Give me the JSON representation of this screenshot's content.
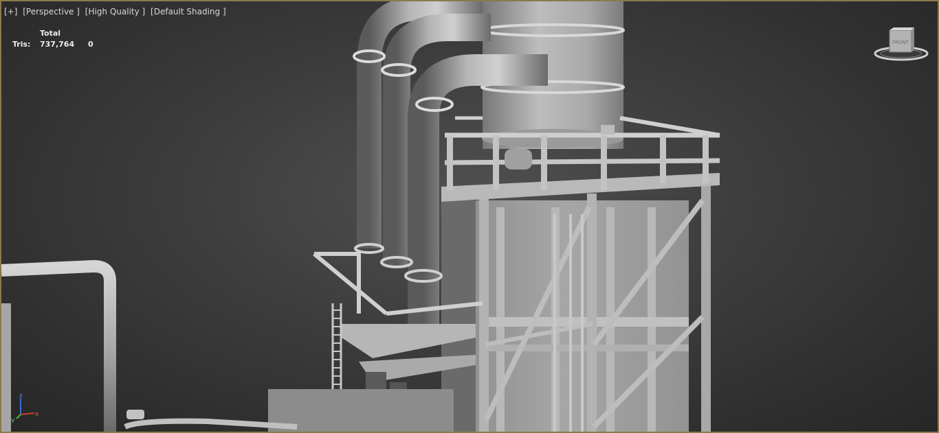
{
  "viewport": {
    "menu": {
      "plus": "[+]",
      "view": "[Perspective ]",
      "quality": "[High Quality ]",
      "shading": "[Default Shading ]"
    },
    "stats": {
      "total_label": "Total",
      "tris_label": "Tris:",
      "tris_total": "737,764",
      "tris_selected": "0"
    },
    "viewcube": {
      "face_label": "FRONT"
    },
    "axis": {
      "x": "x",
      "y": "y",
      "z": "z"
    }
  },
  "colors": {
    "border": "#8a7a4a",
    "background_center": "#505050",
    "background_edge": "#262626",
    "model": "#9c9c9c",
    "axis_x": "#d23a2a",
    "axis_y": "#3ac03a",
    "axis_z": "#3a6ad2"
  }
}
